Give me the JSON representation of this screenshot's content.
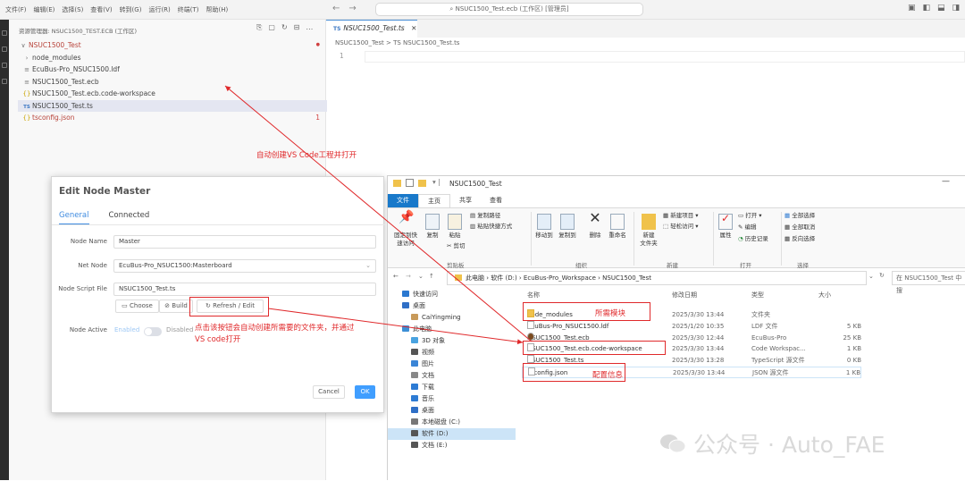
{
  "vscode": {
    "menu": [
      "文件(F)",
      "编辑(E)",
      "选择(S)",
      "查看(V)",
      "转到(G)",
      "运行(R)",
      "终端(T)",
      "帮助(H)"
    ],
    "search_box": "NSUC1500_Test.ecb (工作区) [管理员]",
    "explorer_title": "资源管理器: NSUC1500_TEST.ECB (工作区)",
    "tree": [
      {
        "label": "NSUC1500_Test",
        "icon": "∨",
        "color": "#b8433a",
        "badge": "●"
      },
      {
        "label": "node_modules",
        "icon": "›",
        "color": "#444",
        "badge": ""
      },
      {
        "label": "EcuBus-Pro_NSUC1500.ldf",
        "icon": "≡",
        "color": "#444",
        "badge": ""
      },
      {
        "label": "NSUC1500_Test.ecb",
        "icon": "≡",
        "color": "#444",
        "badge": ""
      },
      {
        "label": "NSUC1500_Test.ecb.code-workspace",
        "icon": "{}",
        "color": "#444",
        "badge": ""
      },
      {
        "label": "NSUC1500_Test.ts",
        "icon": "TS",
        "color": "#444",
        "badge": ""
      },
      {
        "label": "tsconfig.json",
        "icon": "{}",
        "color": "#b8433a",
        "badge": "1"
      }
    ],
    "tab_label": "NSUC1500_Test.ts",
    "tab_icon": "TS",
    "breadcrumb": "NSUC1500_Test  >  TS  NSUC1500_Test.ts",
    "line_number": "1"
  },
  "dialog": {
    "title": "Edit Node Master",
    "tabs": [
      "General",
      "Connected"
    ],
    "node_name_label": "Node Name",
    "node_name_value": "Master",
    "net_node_label": "Net Node",
    "net_node_value": "EcuBus-Pro_NSUC1500:Masterboard",
    "script_label": "Node Script File",
    "script_value": "NSUC1500_Test.ts",
    "choose": "Choose",
    "build": "Build",
    "refresh": "Refresh / Edit",
    "active_label": "Node Active",
    "enabled": "Enabled",
    "disabled": "Disabled",
    "cancel": "Cancel",
    "ok": "OK"
  },
  "explorer": {
    "title": "NSUC1500_Test",
    "ribbon_tabs": [
      "文件",
      "主页",
      "共享",
      "查看"
    ],
    "buttons": {
      "pin": "固定到快\n速访问",
      "copy": "复制",
      "paste": "粘贴",
      "copy_path": "复制路径",
      "paste_shortcut": "粘贴快捷方式",
      "cut": "剪切",
      "move_to": "移动到",
      "copy_to": "复制到",
      "delete": "删除",
      "rename": "重命名",
      "new_folder": "新建\n文件夹",
      "new_item": "新建项目 ▾",
      "easy_access": "轻松访问 ▾",
      "properties": "属性",
      "open": "打开 ▾",
      "edit": "编辑",
      "history": "历史记录",
      "select_all": "全部选择",
      "select_none": "全部取消",
      "invert": "反向选择"
    },
    "groups": [
      "剪贴板",
      "组织",
      "新建",
      "打开",
      "选择"
    ],
    "address": "此电脑  ›  软件 (D:)  ›  EcuBus-Pro_Workspace  ›  NSUC1500_Test",
    "search": "在 NSUC1500_Test 中搜",
    "nav": [
      {
        "label": "快速访问",
        "color": "#2b78d0"
      },
      {
        "label": "桌面",
        "color": "#2f6fc6"
      },
      {
        "label": "CaiYingming",
        "color": "#c89a5a"
      },
      {
        "label": "此电脑",
        "color": "#3c8fd6"
      },
      {
        "label": "3D 对象",
        "color": "#4aa3e0"
      },
      {
        "label": "视频",
        "color": "#555"
      },
      {
        "label": "图片",
        "color": "#3a85d6"
      },
      {
        "label": "文档",
        "color": "#888"
      },
      {
        "label": "下载",
        "color": "#2d7bd4"
      },
      {
        "label": "音乐",
        "color": "#2d7bd4"
      },
      {
        "label": "桌面",
        "color": "#2f6fc6"
      },
      {
        "label": "本地磁盘 (C:)",
        "color": "#777"
      },
      {
        "label": "软件 (D:)",
        "color": "#555"
      },
      {
        "label": "文档 (E:)",
        "color": "#555"
      }
    ],
    "columns": [
      "名称",
      "修改日期",
      "类型",
      "大小"
    ],
    "files": [
      {
        "name": "node_modules",
        "date": "2025/3/30 13:44",
        "type": "文件夹",
        "size": "",
        "icon": "#f0c24b"
      },
      {
        "name": "EcuBus-Pro_NSUC1500.ldf",
        "date": "2025/1/20 10:35",
        "type": "LDF 文件",
        "size": "5 KB",
        "icon": "#fff"
      },
      {
        "name": "NSUC1500_Test.ecb",
        "date": "2025/3/30 12:44",
        "type": "EcuBus-Pro",
        "size": "25 KB",
        "icon": "#7a4a1f"
      },
      {
        "name": "NSUC1500_Test.ecb.code-workspace",
        "date": "2025/3/30 13:44",
        "type": "Code Workspac...",
        "size": "1 KB",
        "icon": "#fff"
      },
      {
        "name": "NSUC1500_Test.ts",
        "date": "2025/3/30 13:28",
        "type": "TypeScript 源文件",
        "size": "0 KB",
        "icon": "#fff"
      },
      {
        "name": "tsconfig.json",
        "date": "2025/3/30 13:44",
        "type": "JSON 源文件",
        "size": "1 KB",
        "icon": "#fff"
      }
    ]
  },
  "annotations": {
    "auto_create": "自动创建VS Code工程并打开",
    "click_hint_1": "点击该按钮会自动创建所需要的文件夹，并通过",
    "click_hint_2": "VS code打开",
    "required_modules": "所需模块",
    "config_info": "配置信息"
  },
  "watermark": "公众号 · Auto_FAE",
  "colors": {
    "accent": "#409eff",
    "annotation": "#e0292b",
    "file_tab": "#1979ca"
  }
}
